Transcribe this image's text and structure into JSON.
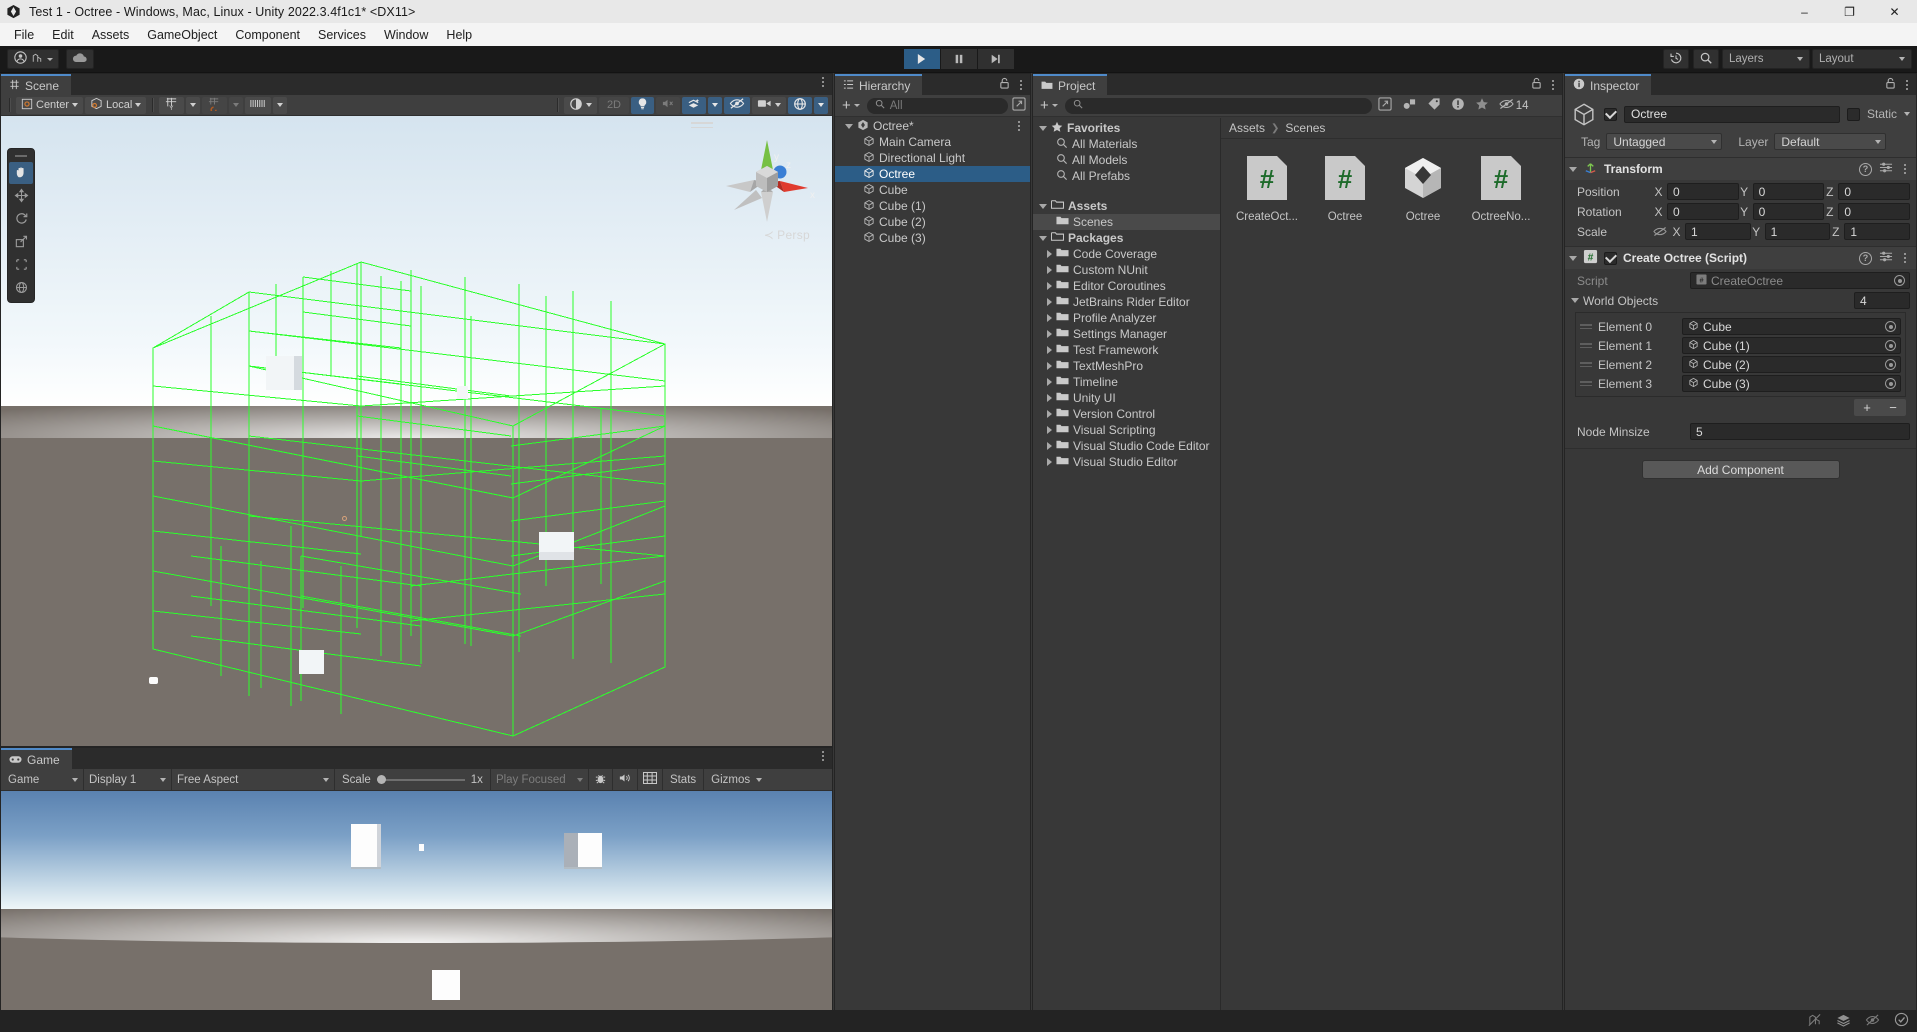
{
  "window": {
    "title": "Test 1 - Octree - Windows, Mac, Linux - Unity 2022.3.4f1c1* <DX11>",
    "minimize": "–",
    "maximize": "❐",
    "close": "✕"
  },
  "menubar": {
    "items": [
      "File",
      "Edit",
      "Assets",
      "GameObject",
      "Component",
      "Services",
      "Window",
      "Help"
    ]
  },
  "toolbar": {
    "account_icon": "account-icon",
    "cloud_icon": "cloud-icon",
    "play": "▶",
    "pause": "❙❙",
    "step": "▶|",
    "undo_history_icon": "undo-history-icon",
    "search_icon": "search-icon",
    "layers_label": "Layers",
    "layout_label": "Layout"
  },
  "scene": {
    "tab_label": "Scene",
    "pivot_label": "Center",
    "handle_label": "Local",
    "grid_icon": "grid-snap-icon",
    "snap_icon": "snap-increment-icon",
    "ruler_icon": "ruler-icon",
    "shading_icon": "shading-mode-icon",
    "mode_2d": "2D",
    "light_icon": "lighting-icon",
    "audio_icon": "audio-mute-icon",
    "fx_icon": "effects-icon",
    "hidden_icon": "visibility-toggle-icon",
    "camera_icon": "scene-camera-icon",
    "gizmos_icon": "gizmos-icon",
    "persp_label": "Persp",
    "axis_x": "x",
    "axis_y": "y",
    "axis_z": "z",
    "tools": [
      {
        "name": "hand-tool-icon",
        "selected": true
      },
      {
        "name": "move-tool-icon",
        "selected": false
      },
      {
        "name": "rotate-tool-icon",
        "selected": false
      },
      {
        "name": "scale-tool-icon",
        "selected": false
      },
      {
        "name": "rect-tool-icon",
        "selected": false
      },
      {
        "name": "transform-tool-icon",
        "selected": false
      }
    ]
  },
  "game": {
    "tab_label": "Game",
    "target_label": "Game",
    "display_label": "Display 1",
    "aspect_label": "Free Aspect",
    "scale_label": "Scale",
    "scale_value": "1x",
    "play_mode_label": "Play Focused",
    "mute_icon": "mute-audio-icon",
    "bug_icon": "debug-icon",
    "grid_icon": "game-grid-icon",
    "stats_label": "Stats",
    "gizmos_label": "Gizmos"
  },
  "hierarchy": {
    "tab_label": "Hierarchy",
    "lock_icon": "lock-icon",
    "add_label": "+",
    "search_placeholder": "All",
    "scene_name": "Octree*",
    "items": [
      {
        "label": "Main Camera",
        "selected": false
      },
      {
        "label": "Directional Light",
        "selected": false
      },
      {
        "label": "Octree",
        "selected": true
      },
      {
        "label": "Cube",
        "selected": false
      },
      {
        "label": "Cube (1)",
        "selected": false
      },
      {
        "label": "Cube (2)",
        "selected": false
      },
      {
        "label": "Cube (3)",
        "selected": false
      }
    ]
  },
  "project": {
    "tab_label": "Project",
    "add_label": "+",
    "search_placeholder": "",
    "hidden_count": "14",
    "tree": [
      {
        "label": "Favorites",
        "depth": 0,
        "kind": "star",
        "expander": "down",
        "bold": true
      },
      {
        "label": "All Materials",
        "depth": 1,
        "kind": "search",
        "expander": "none",
        "bold": false
      },
      {
        "label": "All Models",
        "depth": 1,
        "kind": "search",
        "expander": "none",
        "bold": false
      },
      {
        "label": "All Prefabs",
        "depth": 1,
        "kind": "search",
        "expander": "none",
        "bold": false
      },
      {
        "label": "",
        "depth": 0,
        "kind": "gap",
        "expander": "none",
        "bold": false
      },
      {
        "label": "Assets",
        "depth": 0,
        "kind": "folder-open",
        "expander": "down",
        "bold": true
      },
      {
        "label": "Scenes",
        "depth": 1,
        "kind": "folder",
        "expander": "none",
        "bold": false,
        "selected": true
      },
      {
        "label": "Packages",
        "depth": 0,
        "kind": "folder-open",
        "expander": "down",
        "bold": true
      },
      {
        "label": "Code Coverage",
        "depth": 1,
        "kind": "folder",
        "expander": "right",
        "bold": false
      },
      {
        "label": "Custom NUnit",
        "depth": 1,
        "kind": "folder",
        "expander": "right",
        "bold": false
      },
      {
        "label": "Editor Coroutines",
        "depth": 1,
        "kind": "folder",
        "expander": "right",
        "bold": false
      },
      {
        "label": "JetBrains Rider Editor",
        "depth": 1,
        "kind": "folder",
        "expander": "right",
        "bold": false
      },
      {
        "label": "Profile Analyzer",
        "depth": 1,
        "kind": "folder",
        "expander": "right",
        "bold": false
      },
      {
        "label": "Settings Manager",
        "depth": 1,
        "kind": "folder",
        "expander": "right",
        "bold": false
      },
      {
        "label": "Test Framework",
        "depth": 1,
        "kind": "folder",
        "expander": "right",
        "bold": false
      },
      {
        "label": "TextMeshPro",
        "depth": 1,
        "kind": "folder",
        "expander": "right",
        "bold": false
      },
      {
        "label": "Timeline",
        "depth": 1,
        "kind": "folder",
        "expander": "right",
        "bold": false
      },
      {
        "label": "Unity UI",
        "depth": 1,
        "kind": "folder",
        "expander": "right",
        "bold": false
      },
      {
        "label": "Version Control",
        "depth": 1,
        "kind": "folder",
        "expander": "right",
        "bold": false
      },
      {
        "label": "Visual Scripting",
        "depth": 1,
        "kind": "folder",
        "expander": "right",
        "bold": false
      },
      {
        "label": "Visual Studio Code Editor",
        "depth": 1,
        "kind": "folder",
        "expander": "right",
        "bold": false
      },
      {
        "label": "Visual Studio Editor",
        "depth": 1,
        "kind": "folder",
        "expander": "right",
        "bold": false
      }
    ],
    "breadcrumb": [
      "Assets",
      "Scenes"
    ],
    "assets": [
      {
        "label": "CreateOct...",
        "icon": "csharp-script-icon"
      },
      {
        "label": "Octree",
        "icon": "csharp-script-icon"
      },
      {
        "label": "Octree",
        "icon": "unity-scene-icon"
      },
      {
        "label": "OctreeNo...",
        "icon": "csharp-script-icon"
      }
    ]
  },
  "inspector": {
    "tab_label": "Inspector",
    "lock_icon": "lock-icon",
    "object_name": "Octree",
    "enabled": true,
    "static_label": "Static",
    "tag_label": "Tag",
    "tag_value": "Untagged",
    "layer_label": "Layer",
    "layer_value": "Default",
    "components": [
      {
        "title": "Transform",
        "icon": "transform-icon",
        "rows": [
          {
            "name": "Position",
            "x": "0",
            "y": "0",
            "z": "0"
          },
          {
            "name": "Rotation",
            "x": "0",
            "y": "0",
            "z": "0"
          },
          {
            "name": "Scale",
            "x": "1",
            "y": "1",
            "z": "1",
            "constrain_icon": "constrain-proportions-icon"
          }
        ]
      }
    ],
    "script_component": {
      "title": "Create Octree (Script)",
      "icon": "csharp-script-icon",
      "enabled": true,
      "script_label": "Script",
      "script_value": "CreateOctree",
      "array_label": "World Objects",
      "array_size": "4",
      "elements": [
        {
          "name": "Element 0",
          "value": "Cube"
        },
        {
          "name": "Element 1",
          "value": "Cube (1)"
        },
        {
          "name": "Element 2",
          "value": "Cube (2)"
        },
        {
          "name": "Element 3",
          "value": "Cube (3)"
        }
      ],
      "add_label": "+",
      "remove_label": "−",
      "minsize_label": "Node Minsize",
      "minsize_value": "5"
    },
    "add_component_label": "Add Component"
  },
  "statusbar": {
    "icons": [
      "collab-off-icon",
      "layers-stack-icon",
      "preview-off-icon",
      "check-circle-icon"
    ]
  },
  "colors": {
    "accent": "#2c5d87",
    "tab_accent": "#4f8ac9",
    "panel_bg": "#383838",
    "header_bg": "#3f3f3f",
    "toolbar_bg": "#191919",
    "wire_green": "#2bff2b",
    "scene_ground": "#77706a"
  }
}
